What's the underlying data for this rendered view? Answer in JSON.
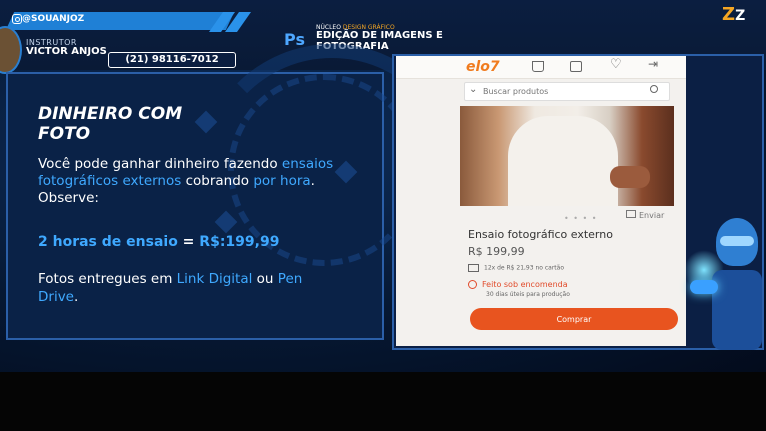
{
  "header": {
    "handle": "@SOUANJOZ",
    "instructor_role": "INSTRUTOR",
    "instructor_name": "VICTOR ANJOS",
    "phone": "(21) 98116-7012",
    "ps_logo": "Ps",
    "course_prefix": "NÚCLEO",
    "course_highlight": "DESIGN GRÁFICO",
    "course_title": "EDIÇÃO DE IMAGENS E FOTOGRAFIA",
    "brand": "Z",
    "brand_suffix": "Z"
  },
  "slide": {
    "heading": "DINHEIRO COM FOTO",
    "p1_a": "Você pode ganhar dinheiro fazendo ",
    "p1_hl1": "ensaios fotográficos externos",
    "p1_b": " cobrando ",
    "p1_hl2": "por hora",
    "p1_c": ". Observe:",
    "price_a": "2 horas de ensaio",
    "price_eq": " = ",
    "price_b": "R$:199,99",
    "delivery_a": "Fotos entregues em ",
    "delivery_hl1": "Link Digital",
    "delivery_b": " ou ",
    "delivery_hl2": "Pen Drive",
    "delivery_c": "."
  },
  "store": {
    "logo": "elo7",
    "search_placeholder": "Buscar produtos",
    "share_label": "Enviar",
    "product_title": "Ensaio fotográfico externo",
    "product_price": "R$ 199,99",
    "installments": "12x de R$ 21,93 no cartão",
    "made_to_order": "Feito sob encomenda",
    "production_days": "30 dias úteis para produção",
    "buy_label": "Comprar",
    "carousel_dots": "• • • •"
  },
  "colors": {
    "accent_blue": "#3fa9ff",
    "store_orange": "#e8541f",
    "brand_orange": "#f5a623"
  }
}
